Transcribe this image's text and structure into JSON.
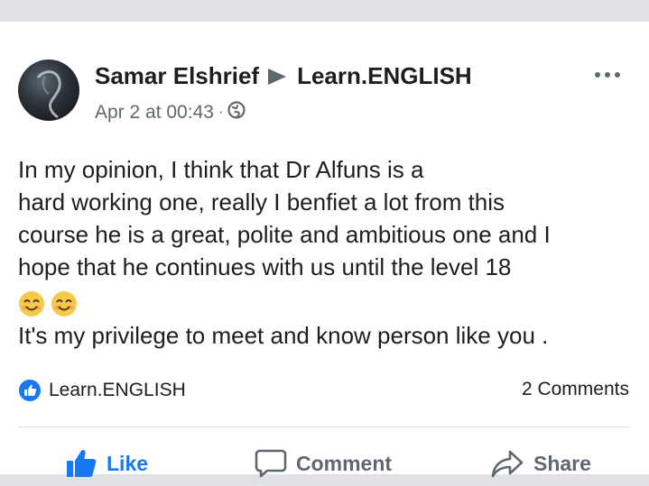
{
  "post": {
    "author": "Samar Elshrief",
    "group": "Learn.ENGLISH",
    "timestamp": "Apr 2 at 00:43",
    "separator": "·",
    "privacy_icon": "globe-icon",
    "more_icon": "more-options-icon",
    "text_lines": [
      "In my opinion, I  think that Dr Alfuns is a",
      " hard working one, really I benfiet a lot from this",
      "course he is a great, polite and ambitious one and I",
      "hope that he continues with us until the level 18"
    ],
    "emojis": [
      "smiling-face-icon",
      "smiling-face-icon"
    ],
    "closing_line": "It's my privilege to meet and know person like you ."
  },
  "footer": {
    "group_badge": "like-badge-icon",
    "group_label": "Learn.ENGLISH",
    "comments_count": "2 Comments"
  },
  "actions": {
    "like": "Like",
    "comment": "Comment",
    "share": "Share"
  },
  "colors": {
    "accent": "#1877f2",
    "text": "#1c1e21",
    "secondary": "#606770",
    "background": "#dfe1e5"
  }
}
